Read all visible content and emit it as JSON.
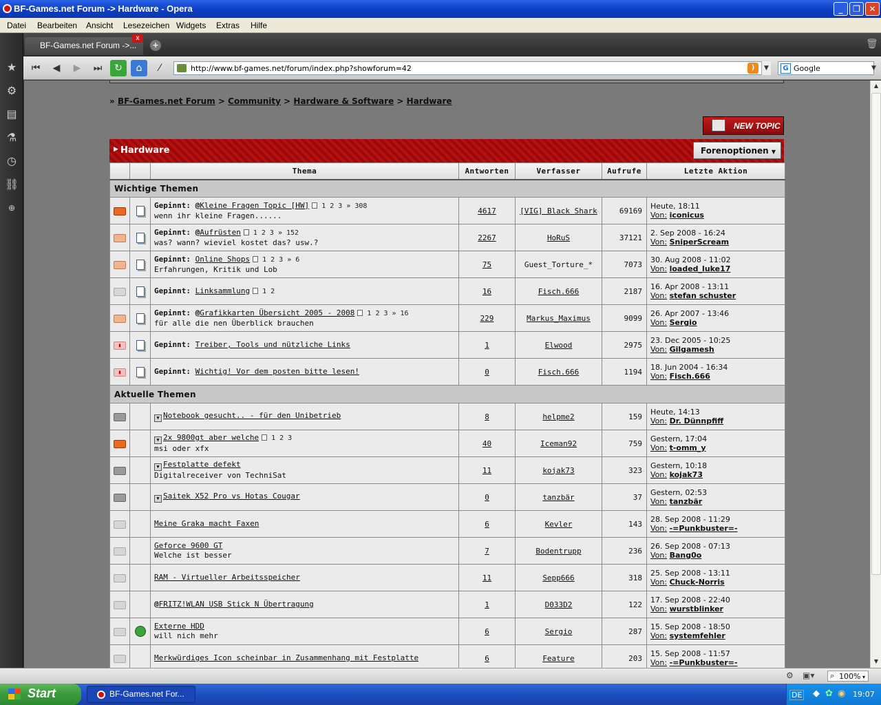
{
  "window": {
    "title": "BF-Games.net Forum -> Hardware - Opera"
  },
  "menu": [
    "Datei",
    "Bearbeiten",
    "Ansicht",
    "Lesezeichen",
    "Widgets",
    "Extras",
    "Hilfe"
  ],
  "tab": {
    "label": "BF-Games.net Forum ->..."
  },
  "address": {
    "url": "http://www.bf-games.net/forum/index.php?showforum=42"
  },
  "search": {
    "engine": "Google"
  },
  "breadcrumb": {
    "root": "BF-Games.net Forum",
    "sep": ">",
    "c1": "Community",
    "c2": "Hardware & Software",
    "c3": "Hardware"
  },
  "forum": {
    "new_topic": "NEW TOPIC",
    "title": "Hardware",
    "options": "Forenoptionen"
  },
  "columns": {
    "thema": "Thema",
    "antworten": "Antworten",
    "verfasser": "Verfasser",
    "aufrufe": "Aufrufe",
    "letzte": "Letzte Aktion"
  },
  "sections": {
    "pinned": "Wichtige Themen",
    "current": "Aktuelle Themen"
  },
  "pinned_label": "Gepinnt:",
  "von_label": "Von:",
  "pinned": [
    {
      "icon": "hot",
      "poll": true,
      "title": "Kleine Fragen Topic [HW]",
      "desc": "wenn ihr kleine Fragen......",
      "pages": [
        "1",
        "2",
        "3",
        "» 308"
      ],
      "replies": "4617",
      "author": "[VIG] Black Shark",
      "views": "69169",
      "last_date": "Heute, 18:11",
      "last_user": "iconicus"
    },
    {
      "icon": "warm",
      "poll": true,
      "title": "Aufrüsten",
      "desc": "was? wann? wieviel kostet das? usw.?",
      "pages": [
        "1",
        "2",
        "3",
        "» 152"
      ],
      "replies": "2267",
      "author": "HoRuS",
      "views": "37121",
      "last_date": "2. Sep 2008 - 16:24",
      "last_user": "SniperScream"
    },
    {
      "icon": "warm",
      "poll": false,
      "title": "Online Shops",
      "desc": "Erfahrungen, Kritik und Lob",
      "pages": [
        "1",
        "2",
        "3",
        "» 6"
      ],
      "replies": "75",
      "author": "Guest_Torture_*",
      "views": "7073",
      "last_date": "30. Aug 2008 - 11:02",
      "last_user": "loaded_luke17"
    },
    {
      "icon": "light",
      "poll": false,
      "title": "Linksammlung",
      "desc": "",
      "pages": [
        "1",
        "2"
      ],
      "replies": "16",
      "author": "Fisch.666",
      "views": "2187",
      "last_date": "16. Apr 2008 - 13:11",
      "last_user": "stefan schuster"
    },
    {
      "icon": "warm",
      "poll": true,
      "title": "Grafikkarten Übersicht 2005 - 2008",
      "desc": "für alle die nen Überblick brauchen",
      "pages": [
        "1",
        "2",
        "3",
        "» 16"
      ],
      "replies": "229",
      "author": "Markus_Maximus",
      "views": "9099",
      "last_date": "26. Apr 2007 - 13:46",
      "last_user": "Sergio"
    },
    {
      "icon": "lock",
      "poll": false,
      "title": "Treiber, Tools und nützliche Links",
      "desc": "",
      "pages": [],
      "replies": "1",
      "author": "Elwood",
      "views": "2975",
      "last_date": "23. Dec 2005 - 10:25",
      "last_user": "Gilgamesh"
    },
    {
      "icon": "lock",
      "poll": false,
      "title": "Wichtig! Vor dem posten bitte lesen!",
      "desc": "",
      "pages": [],
      "replies": "0",
      "author": "Fisch.666",
      "views": "1194",
      "last_date": "18. Jun 2004 - 16:34",
      "last_user": "Fisch.666"
    }
  ],
  "current": [
    {
      "icon": "grey",
      "attach": false,
      "box": true,
      "poll": false,
      "title": "Notebook gesucht.. - für den Unibetrieb",
      "desc": "",
      "pages": [],
      "replies": "8",
      "author": "helpme2",
      "views": "159",
      "last_date": "Heute, 14:13",
      "last_user": "Dr. Dünnpfiff"
    },
    {
      "icon": "hot",
      "attach": false,
      "box": true,
      "poll": false,
      "title": "2x 9800gt aber welche",
      "desc": "msi oder xfx",
      "pages": [
        "1",
        "2",
        "3"
      ],
      "replies": "40",
      "author": "Iceman92",
      "views": "759",
      "last_date": "Gestern, 17:04",
      "last_user": "t-omm_y"
    },
    {
      "icon": "grey",
      "attach": false,
      "box": true,
      "poll": false,
      "title": "Festplatte defekt",
      "desc": "Digitalreceiver von TechniSat",
      "pages": [],
      "replies": "11",
      "author": "kojak73",
      "views": "323",
      "last_date": "Gestern, 10:18",
      "last_user": "kojak73"
    },
    {
      "icon": "grey",
      "attach": false,
      "box": true,
      "poll": false,
      "title": "Saitek X52 Pro vs Hotas Cougar",
      "desc": "",
      "pages": [],
      "replies": "0",
      "author": "tanzbär",
      "views": "37",
      "last_date": "Gestern, 02:53",
      "last_user": "tanzbär"
    },
    {
      "icon": "light",
      "attach": false,
      "box": false,
      "poll": false,
      "title": "Meine Graka macht Faxen",
      "desc": "",
      "pages": [],
      "replies": "6",
      "author": "Kevler",
      "views": "143",
      "last_date": "28. Sep 2008 - 11:29",
      "last_user": "-=Punkbuster=-"
    },
    {
      "icon": "light",
      "attach": false,
      "box": false,
      "poll": false,
      "title": "Geforce 9600 GT",
      "desc": "Welche ist besser",
      "pages": [],
      "replies": "7",
      "author": "Bodentrupp",
      "views": "236",
      "last_date": "26. Sep 2008 - 07:13",
      "last_user": "Bang0o"
    },
    {
      "icon": "light",
      "attach": false,
      "box": false,
      "poll": false,
      "title": "RAM - Virtueller Arbeitsspeicher",
      "desc": "",
      "pages": [],
      "replies": "11",
      "author": "Sepp666",
      "views": "318",
      "last_date": "25. Sep 2008 - 13:11",
      "last_user": "Chuck-Norris"
    },
    {
      "icon": "light",
      "attach": false,
      "box": false,
      "poll": true,
      "title": "FRITZ!WLAN USB Stick N Übertragung",
      "desc": "",
      "pages": [],
      "replies": "1",
      "author": "D033D2",
      "views": "122",
      "last_date": "17. Sep 2008 - 22:40",
      "last_user": "wurstblinker"
    },
    {
      "icon": "light",
      "attach": true,
      "box": false,
      "poll": false,
      "title": "Externe HDD",
      "desc": "will nich mehr",
      "pages": [],
      "replies": "6",
      "author": "Sergio",
      "views": "287",
      "last_date": "15. Sep 2008 - 18:50",
      "last_user": "systemfehler"
    },
    {
      "icon": "light",
      "attach": false,
      "box": false,
      "poll": false,
      "title": "Merkwürdiges Icon scheinbar in Zusammenhang mit Festplatte",
      "desc": "",
      "pages": [],
      "replies": "6",
      "author": "Feature",
      "views": "203",
      "last_date": "15. Sep 2008 - 11:57",
      "last_user": "-=Punkbuster=-"
    }
  ],
  "status": {
    "zoom": "100%"
  },
  "taskbar": {
    "start": "Start",
    "window": "BF-Games.net For...",
    "lang": "DE",
    "clock": "19:07"
  }
}
